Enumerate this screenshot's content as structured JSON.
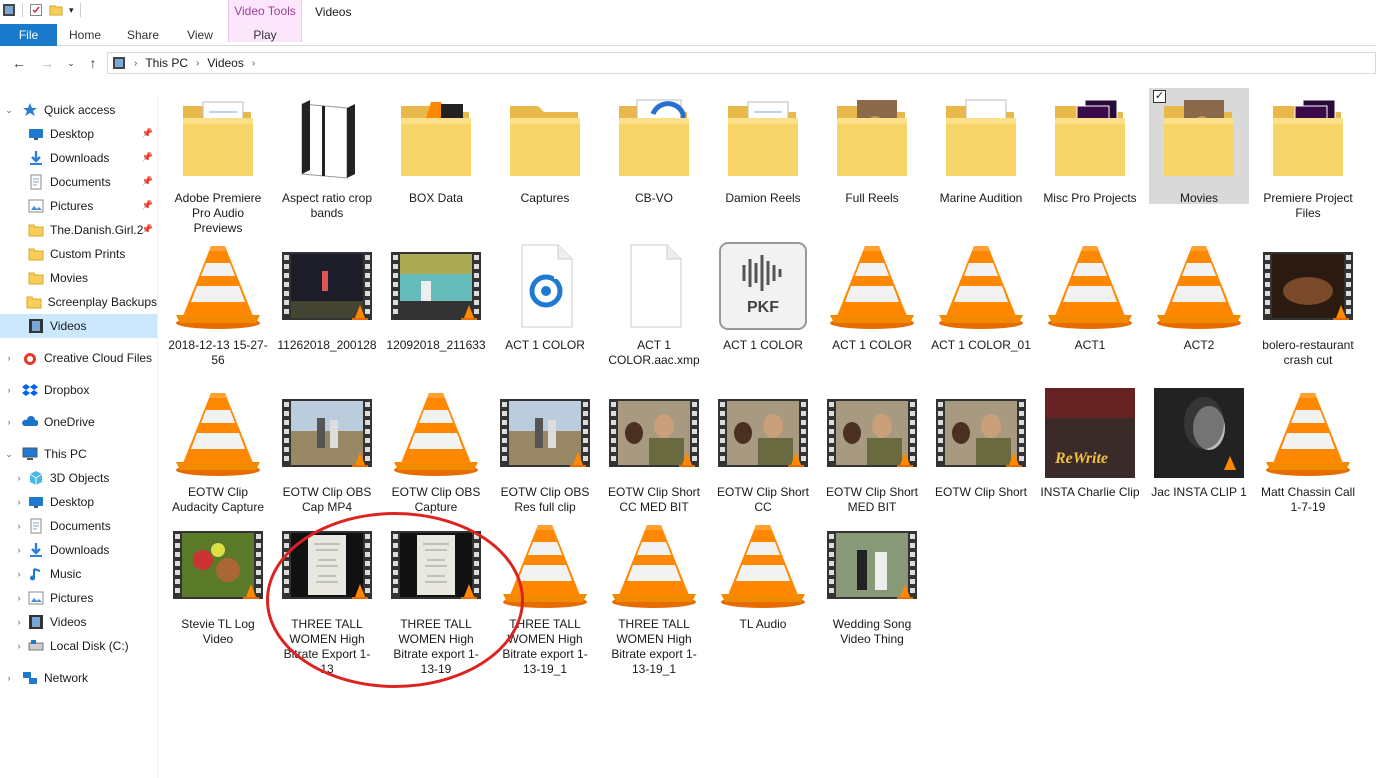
{
  "window": {
    "title": "Videos",
    "context_tab": "Video Tools"
  },
  "ribbon": {
    "tabs": [
      "File",
      "Home",
      "Share",
      "View",
      "Play"
    ]
  },
  "address": {
    "segments": [
      "This PC",
      "Videos"
    ]
  },
  "sidebar": {
    "items": [
      {
        "label": "Quick access",
        "icon": "star-icon",
        "level": 0,
        "expanded": true,
        "pinned": false
      },
      {
        "label": "Desktop",
        "icon": "desktop-icon",
        "level": 1,
        "pinned": true
      },
      {
        "label": "Downloads",
        "icon": "download-icon",
        "level": 1,
        "pinned": true
      },
      {
        "label": "Documents",
        "icon": "documents-icon",
        "level": 1,
        "pinned": true
      },
      {
        "label": "Pictures",
        "icon": "pictures-icon",
        "level": 1,
        "pinned": true
      },
      {
        "label": "The.Danish.Girl.2",
        "icon": "folder-icon",
        "level": 1,
        "pinned": true
      },
      {
        "label": "Custom Prints",
        "icon": "folder-icon",
        "level": 1,
        "pinned": false
      },
      {
        "label": "Movies",
        "icon": "folder-icon",
        "level": 1,
        "pinned": false
      },
      {
        "label": "Screenplay Backups",
        "icon": "folder-icon",
        "level": 1,
        "pinned": false
      },
      {
        "label": "Videos",
        "icon": "videos-icon",
        "level": 1,
        "pinned": false,
        "selected": true
      },
      {
        "label": "Creative Cloud Files",
        "icon": "cc-icon",
        "level": 0,
        "collapsed": true
      },
      {
        "label": "Dropbox",
        "icon": "dropbox-icon",
        "level": 0,
        "collapsed": true
      },
      {
        "label": "OneDrive",
        "icon": "onedrive-icon",
        "level": 0,
        "collapsed": true
      },
      {
        "label": "This PC",
        "icon": "pc-icon",
        "level": 0,
        "expanded": true
      },
      {
        "label": "3D Objects",
        "icon": "3d-icon",
        "level": 1,
        "collapsed": true
      },
      {
        "label": "Desktop",
        "icon": "desktop-icon",
        "level": 1,
        "collapsed": true
      },
      {
        "label": "Documents",
        "icon": "documents-icon",
        "level": 1,
        "collapsed": true
      },
      {
        "label": "Downloads",
        "icon": "download-icon",
        "level": 1,
        "collapsed": true
      },
      {
        "label": "Music",
        "icon": "music-icon",
        "level": 1,
        "collapsed": true
      },
      {
        "label": "Pictures",
        "icon": "pictures-icon",
        "level": 1,
        "collapsed": true
      },
      {
        "label": "Videos",
        "icon": "videos-icon",
        "level": 1,
        "collapsed": true
      },
      {
        "label": "Local Disk (C:)",
        "icon": "disk-icon",
        "level": 1,
        "collapsed": true
      },
      {
        "label": "Network",
        "icon": "network-icon",
        "level": 0,
        "collapsed": true
      }
    ]
  },
  "files": [
    {
      "label": "Adobe Premiere Pro Audio Previews",
      "kind": "folder-docs"
    },
    {
      "label": "Aspect ratio crop bands",
      "kind": "folder-dark"
    },
    {
      "label": "BOX Data",
      "kind": "folder-vlc"
    },
    {
      "label": "Captures",
      "kind": "folder"
    },
    {
      "label": "CB-VO",
      "kind": "folder-audio"
    },
    {
      "label": "Damion Reels",
      "kind": "folder-docs"
    },
    {
      "label": "Full Reels",
      "kind": "folder-photo"
    },
    {
      "label": "Marine Audition",
      "kind": "folder-ring"
    },
    {
      "label": "Misc Pro Projects",
      "kind": "folder-pr"
    },
    {
      "label": "Movies",
      "kind": "folder-photo",
      "selected": true
    },
    {
      "label": "Premiere Project Files",
      "kind": "folder-pr"
    },
    {
      "label": "2018-12-13 15-27-56",
      "kind": "vlc"
    },
    {
      "label": "11262018_200128",
      "kind": "video-stage"
    },
    {
      "label": "12092018_211633",
      "kind": "video-stage2"
    },
    {
      "label": "ACT 1 COLOR",
      "kind": "audio-ring"
    },
    {
      "label": "ACT 1 COLOR.aac.xmp",
      "kind": "blank-doc"
    },
    {
      "label": "ACT 1 COLOR",
      "kind": "pkf"
    },
    {
      "label": "ACT 1 COLOR",
      "kind": "vlc"
    },
    {
      "label": "ACT 1 COLOR_01",
      "kind": "vlc"
    },
    {
      "label": "ACT1",
      "kind": "vlc"
    },
    {
      "label": "ACT2",
      "kind": "vlc"
    },
    {
      "label": "bolero-restaurant crash cut",
      "kind": "video-dark"
    },
    {
      "label": "EOTW Clip Audacity Capture",
      "kind": "vlc"
    },
    {
      "label": "EOTW Clip OBS Cap MP4",
      "kind": "video-outdoor"
    },
    {
      "label": "EOTW Clip OBS Capture",
      "kind": "vlc"
    },
    {
      "label": "EOTW Clip OBS Res full clip",
      "kind": "video-outdoor"
    },
    {
      "label": "EOTW Clip Short CC MED BIT",
      "kind": "video-soldier"
    },
    {
      "label": "EOTW Clip Short CC",
      "kind": "video-soldier"
    },
    {
      "label": "EOTW Clip Short MED BIT",
      "kind": "video-soldier"
    },
    {
      "label": "EOTW Clip Short",
      "kind": "video-soldier"
    },
    {
      "label": "INSTA Charlie Clip",
      "kind": "image-rewrite"
    },
    {
      "label": "Jac INSTA CLIP 1",
      "kind": "image-bw"
    },
    {
      "label": "Matt Chassin Call 1-7-19",
      "kind": "vlc"
    },
    {
      "label": "Stevie TL Log Video",
      "kind": "video-garden"
    },
    {
      "label": "THREE TALL WOMEN High Bitrate Export 1-13",
      "kind": "video-doc"
    },
    {
      "label": "THREE TALL WOMEN High Bitrate export 1-13-19",
      "kind": "video-doc"
    },
    {
      "label": "THREE TALL WOMEN High Bitrate export 1-13-19_1",
      "kind": "vlc"
    },
    {
      "label": "THREE TALL WOMEN High Bitrate export 1-13-19_1",
      "kind": "vlc"
    },
    {
      "label": "TL Audio",
      "kind": "vlc"
    },
    {
      "label": "Wedding Song Video Thing",
      "kind": "video-wedding"
    }
  ],
  "pkf_text": "PKF"
}
